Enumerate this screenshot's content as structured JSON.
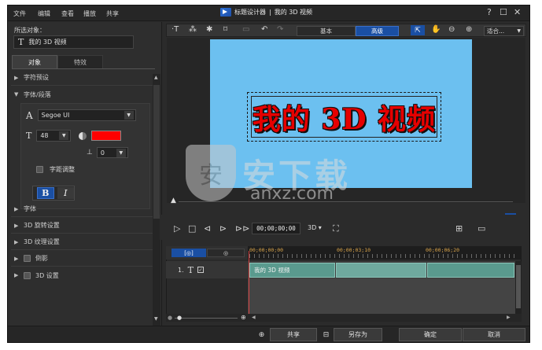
{
  "menu": [
    "文件",
    "编辑",
    "查看",
    "播放",
    "共享"
  ],
  "title": {
    "app": "标题设计器",
    "separator": "|",
    "doc": "我的 3D 视频"
  },
  "window_controls": {
    "help": "?",
    "maximize": "☐",
    "close": "✕"
  },
  "left": {
    "selected_label": "所选对象：",
    "selected_object": "我的 3D 视频",
    "tabs": [
      "对象",
      "特效"
    ],
    "sections": {
      "char_preset": "字符预设",
      "font_paragraph": "字体/段落",
      "font": "字体",
      "rotation_3d": "3D 旋转设置",
      "texture_3d": "3D 纹理设置",
      "shadow": "倒影",
      "settings_3d": "3D 设置"
    },
    "font_face": "Segoe UI",
    "font_size": "48",
    "text_color": "#ff0000",
    "line_spacing": "0",
    "kerning_label": "字距调整",
    "bold": "B",
    "italic": "I"
  },
  "toolbar": {
    "basic": "基本",
    "advanced": "高级",
    "fit": "适合...",
    "fit_arrow": "▼"
  },
  "preview": {
    "title_text": "我的 3D 视频",
    "bg_color": "#6cc0f0"
  },
  "playback": {
    "timecode": "00;00;00;00",
    "mode": "3D ▾"
  },
  "timeline": {
    "tab_video": "[◎]",
    "tab_audio": "◎",
    "marks": [
      "00;00;00;00",
      "00;00;03;10",
      "00;00;06;20"
    ],
    "track_number": "1.",
    "clip_label": "我的 3D 视频"
  },
  "footer": {
    "share": "共享",
    "save_as": "另存为",
    "ok": "确定",
    "cancel": "取消"
  },
  "watermark": {
    "cn": "安下载",
    "en": "anxz.com",
    "shield": "安"
  }
}
